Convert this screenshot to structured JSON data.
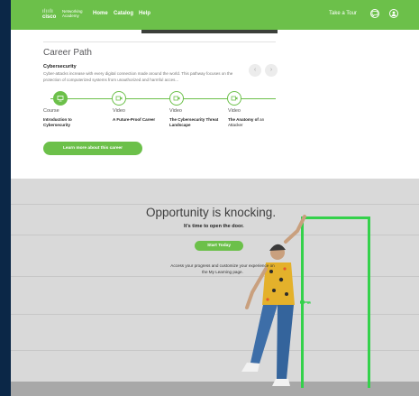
{
  "navbar": {
    "logo_bars": "ılıılı",
    "logo_cisco": "cisco",
    "logo_text": "Networking Academy",
    "links": [
      "Home",
      "Catalog",
      "Help"
    ],
    "take_tour": "Take a Tour",
    "chat_icon": "chat-icon",
    "user_icon": "user-icon"
  },
  "career_path": {
    "title": "Career Path",
    "subtitle": "Cybersecurity",
    "description": "Cyber-attacks increase with every digital connection made around the world. This pathway focuses on the protection of computerized systems from unauthorized and harmful acces...",
    "prev_arrow": "‹",
    "next_arrow": "›",
    "steps": [
      {
        "type": "Course",
        "title": "Introduction to Cybersecurity",
        "title_extra": ""
      },
      {
        "type": "Video",
        "title": "A Future-Proof Career",
        "title_extra": ""
      },
      {
        "type": "Video",
        "title": "The Cybersecurity Threat Landscape",
        "title_extra": ""
      },
      {
        "type": "Video",
        "title": "The Anatomy of",
        "title_extra": "an Attacker"
      }
    ],
    "learn_more_button": "Learn more about this career"
  },
  "opportunity": {
    "title": "Opportunity is knocking.",
    "subtitle": "It's time to open the door.",
    "start_button": "Start Today",
    "description": "Access your progress and customize your experience on the My Learning page."
  },
  "colors": {
    "brand_green": "#6cc04a",
    "door_green": "#34d14b",
    "background_navy": "#0b2747"
  }
}
